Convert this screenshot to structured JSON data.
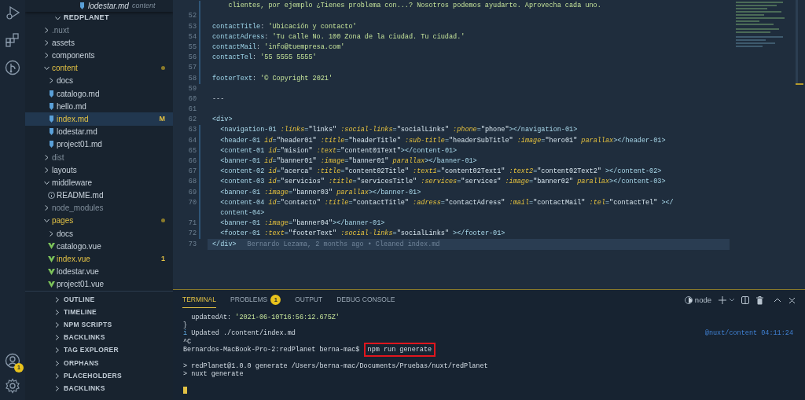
{
  "activity_bar": {
    "top": [
      {
        "kind": "run"
      },
      {
        "kind": "extensions"
      },
      {
        "kind": "git"
      }
    ],
    "bottom": [
      {
        "kind": "account",
        "badge": "1"
      },
      {
        "kind": "settings"
      }
    ]
  },
  "explorer": {
    "sticky": {
      "name": "lodestar.md",
      "detail": "content"
    },
    "root": "REDPLANET",
    "expanded": true,
    "items": [
      {
        "name": ".nuxt",
        "kind": "folder",
        "expanded": false,
        "ignored": true,
        "modified": false
      },
      {
        "name": "assets",
        "kind": "folder",
        "expanded": false,
        "ignored": false,
        "modified": false
      },
      {
        "name": "components",
        "kind": "folder",
        "expanded": false,
        "ignored": false,
        "modified": false
      },
      {
        "name": "content",
        "kind": "folder",
        "expanded": true,
        "ignored": false,
        "modified": true,
        "dot": true,
        "children": [
          {
            "name": "docs",
            "kind": "folder",
            "expanded": false,
            "ignored": false,
            "modified": false
          },
          {
            "name": "catalogo.md",
            "kind": "md",
            "ignored": false,
            "modified": false,
            "selected": false
          },
          {
            "name": "hello.md",
            "kind": "md",
            "ignored": false,
            "modified": false,
            "selected": false
          },
          {
            "name": "index.md",
            "kind": "md",
            "ignored": false,
            "modified": true,
            "badge": "M",
            "selected": true
          },
          {
            "name": "lodestar.md",
            "kind": "md",
            "ignored": false,
            "modified": false,
            "selected": false
          },
          {
            "name": "project01.md",
            "kind": "md",
            "ignored": false,
            "modified": false,
            "selected": false
          }
        ]
      },
      {
        "name": "dist",
        "kind": "folder",
        "expanded": false,
        "ignored": true,
        "modified": false
      },
      {
        "name": "layouts",
        "kind": "folder",
        "expanded": false,
        "ignored": false,
        "modified": false
      },
      {
        "name": "middleware",
        "kind": "folder",
        "expanded": true,
        "ignored": false,
        "modified": false,
        "children": [
          {
            "name": "README.md",
            "kind": "info",
            "ignored": false,
            "modified": false,
            "selected": false
          }
        ]
      },
      {
        "name": "node_modules",
        "kind": "folder",
        "expanded": false,
        "ignored": true,
        "modified": false
      },
      {
        "name": "pages",
        "kind": "folder",
        "expanded": true,
        "ignored": false,
        "modified": true,
        "dot": true,
        "children": [
          {
            "name": "docs",
            "kind": "folder",
            "expanded": false,
            "ignored": false,
            "modified": false
          },
          {
            "name": "catalogo.vue",
            "kind": "vue",
            "ignored": false,
            "modified": false,
            "selected": false
          },
          {
            "name": "index.vue",
            "kind": "vue",
            "ignored": false,
            "modified": true,
            "badge": "1",
            "selected": false
          },
          {
            "name": "lodestar.vue",
            "kind": "vue",
            "ignored": false,
            "modified": false,
            "selected": false
          },
          {
            "name": "project01.vue",
            "kind": "vue",
            "ignored": false,
            "modified": false,
            "selected": false
          }
        ]
      }
    ]
  },
  "sections": [
    {
      "label": "OUTLINE",
      "expanded": false
    },
    {
      "label": "TIMELINE",
      "expanded": false
    },
    {
      "label": "NPM SCRIPTS",
      "expanded": false
    },
    {
      "label": "BACKLINKS",
      "expanded": false
    },
    {
      "label": "TAG EXPLORER",
      "expanded": false
    },
    {
      "label": "ORPHANS",
      "expanded": false
    },
    {
      "label": "PLACEHOLDERS",
      "expanded": false
    },
    {
      "label": "BACKLINKS",
      "expanded": false
    }
  ],
  "editor": {
    "lines": [
      {
        "changed": true,
        "segments": [
          {
            "text": "    clientes, por ejemplo ¿Tienes problema con...? Nosotros podemos ayudarte. Aprovecha cada uno.",
            "kind": "str"
          }
        ]
      },
      {
        "number": "52",
        "changed": true
      },
      {
        "number": "53",
        "changed": true,
        "segments": [
          {
            "text": "contactTitle",
            "kind": "key"
          },
          {
            "text": ": ",
            "kind": "punct"
          },
          {
            "text": "'Ubicación y contacto'",
            "kind": "str"
          }
        ]
      },
      {
        "number": "54",
        "changed": true,
        "segments": [
          {
            "text": "contactAdress",
            "kind": "key"
          },
          {
            "text": ": ",
            "kind": "punct"
          },
          {
            "text": "'Tu calle No. 100 Zona de la ciudad. Tu ciudad.'",
            "kind": "str"
          }
        ]
      },
      {
        "number": "55",
        "changed": true,
        "segments": [
          {
            "text": "contactMail",
            "kind": "key"
          },
          {
            "text": ": ",
            "kind": "punct"
          },
          {
            "text": "'info@tuempresa.com'",
            "kind": "str"
          }
        ]
      },
      {
        "number": "56",
        "changed": true,
        "segments": [
          {
            "text": "contactTel",
            "kind": "key"
          },
          {
            "text": ": ",
            "kind": "punct"
          },
          {
            "text": "'55 5555 5555'",
            "kind": "str"
          }
        ]
      },
      {
        "number": "57",
        "changed": true
      },
      {
        "number": "58",
        "changed": true,
        "segments": [
          {
            "text": "footerText",
            "kind": "key"
          },
          {
            "text": ": ",
            "kind": "punct"
          },
          {
            "text": "'© Copyright 2021'",
            "kind": "str"
          }
        ]
      },
      {
        "number": "59",
        "changed": false
      },
      {
        "number": "60",
        "changed": false,
        "segments": [
          {
            "text": "---",
            "kind": "punct"
          }
        ]
      },
      {
        "number": "61",
        "changed": false
      },
      {
        "number": "62",
        "changed": false,
        "segments": [
          {
            "text": "<div>",
            "kind": "tag"
          }
        ]
      },
      {
        "number": "63",
        "changed": true,
        "segments": [
          {
            "text": "  <navigation-01 ",
            "kind": "tag"
          },
          {
            "text": ":links",
            "kind": "attr"
          },
          {
            "text": "=",
            "kind": "tag"
          },
          {
            "text": "\"links\" ",
            "kind": "val"
          },
          {
            "text": ":social-links",
            "kind": "attr"
          },
          {
            "text": "=",
            "kind": "tag"
          },
          {
            "text": "\"socialLinks\" ",
            "kind": "val"
          },
          {
            "text": ":phone",
            "kind": "attr"
          },
          {
            "text": "=",
            "kind": "tag"
          },
          {
            "text": "\"phone\"",
            "kind": "val"
          },
          {
            "text": "></navigation-01>",
            "kind": "tag"
          }
        ]
      },
      {
        "number": "64",
        "changed": true,
        "segments": [
          {
            "text": "  <header-01 ",
            "kind": "tag"
          },
          {
            "text": "id",
            "kind": "attr"
          },
          {
            "text": "=",
            "kind": "tag"
          },
          {
            "text": "\"header01\" ",
            "kind": "val"
          },
          {
            "text": ":title",
            "kind": "attr"
          },
          {
            "text": "=",
            "kind": "tag"
          },
          {
            "text": "\"headerTitle\" ",
            "kind": "val"
          },
          {
            "text": ":sub-title",
            "kind": "attr"
          },
          {
            "text": "=",
            "kind": "tag"
          },
          {
            "text": "\"headerSubTitle\" ",
            "kind": "val"
          },
          {
            "text": ":image",
            "kind": "attr"
          },
          {
            "text": "=",
            "kind": "tag"
          },
          {
            "text": "\"hero01\" ",
            "kind": "val"
          },
          {
            "text": "parallax",
            "kind": "attr"
          },
          {
            "text": "></header-01>",
            "kind": "tag"
          }
        ]
      },
      {
        "number": "65",
        "changed": true,
        "segments": [
          {
            "text": "  <content-01 ",
            "kind": "tag"
          },
          {
            "text": "id",
            "kind": "attr"
          },
          {
            "text": "=",
            "kind": "tag"
          },
          {
            "text": "\"mision\" ",
            "kind": "val"
          },
          {
            "text": ":text",
            "kind": "attr"
          },
          {
            "text": "=",
            "kind": "tag"
          },
          {
            "text": "\"content01Text\"",
            "kind": "val"
          },
          {
            "text": "></content-01>",
            "kind": "tag"
          }
        ]
      },
      {
        "number": "66",
        "changed": true,
        "segments": [
          {
            "text": "  <banner-01 ",
            "kind": "tag"
          },
          {
            "text": "id",
            "kind": "attr"
          },
          {
            "text": "=",
            "kind": "tag"
          },
          {
            "text": "\"banner01\" ",
            "kind": "val"
          },
          {
            "text": ":image",
            "kind": "attr"
          },
          {
            "text": "=",
            "kind": "tag"
          },
          {
            "text": "\"banner01\" ",
            "kind": "val"
          },
          {
            "text": "parallax",
            "kind": "attr"
          },
          {
            "text": "></banner-01>",
            "kind": "tag"
          }
        ]
      },
      {
        "number": "67",
        "changed": true,
        "segments": [
          {
            "text": "  <content-02 ",
            "kind": "tag"
          },
          {
            "text": "id",
            "kind": "attr"
          },
          {
            "text": "=",
            "kind": "tag"
          },
          {
            "text": "\"acerca\" ",
            "kind": "val"
          },
          {
            "text": ":title",
            "kind": "attr"
          },
          {
            "text": "=",
            "kind": "tag"
          },
          {
            "text": "\"content02Title\" ",
            "kind": "val"
          },
          {
            "text": ":text1",
            "kind": "attr"
          },
          {
            "text": "=",
            "kind": "tag"
          },
          {
            "text": "\"content02Text1\" ",
            "kind": "val"
          },
          {
            "text": ":text2",
            "kind": "attr"
          },
          {
            "text": "=",
            "kind": "tag"
          },
          {
            "text": "\"content02Text2\"",
            "kind": "val"
          },
          {
            "text": " ></content-02>",
            "kind": "tag"
          }
        ]
      },
      {
        "number": "68",
        "changed": true,
        "segments": [
          {
            "text": "  <content-03 ",
            "kind": "tag"
          },
          {
            "text": "id",
            "kind": "attr"
          },
          {
            "text": "=",
            "kind": "tag"
          },
          {
            "text": "\"servicios\" ",
            "kind": "val"
          },
          {
            "text": ":title",
            "kind": "attr"
          },
          {
            "text": "=",
            "kind": "tag"
          },
          {
            "text": "\"servicesTitle\" ",
            "kind": "val"
          },
          {
            "text": ":services",
            "kind": "attr"
          },
          {
            "text": "=",
            "kind": "tag"
          },
          {
            "text": "\"services\" ",
            "kind": "val"
          },
          {
            "text": ":image",
            "kind": "attr"
          },
          {
            "text": "=",
            "kind": "tag"
          },
          {
            "text": "\"banner02\" ",
            "kind": "val"
          },
          {
            "text": "parallax",
            "kind": "attr"
          },
          {
            "text": "></content-03>",
            "kind": "tag"
          }
        ]
      },
      {
        "number": "69",
        "changed": true,
        "segments": [
          {
            "text": "  <banner-01 ",
            "kind": "tag"
          },
          {
            "text": ":image",
            "kind": "attr"
          },
          {
            "text": "=",
            "kind": "tag"
          },
          {
            "text": "\"banner03\" ",
            "kind": "val"
          },
          {
            "text": "parallax",
            "kind": "attr"
          },
          {
            "text": "></banner-01>",
            "kind": "tag"
          }
        ]
      },
      {
        "number": "70",
        "changed": true,
        "segments": [
          {
            "text": "  <content-04 ",
            "kind": "tag"
          },
          {
            "text": "id",
            "kind": "attr"
          },
          {
            "text": "=",
            "kind": "tag"
          },
          {
            "text": "\"contacto\" ",
            "kind": "val"
          },
          {
            "text": ":title",
            "kind": "attr"
          },
          {
            "text": "=",
            "kind": "tag"
          },
          {
            "text": "\"contactTitle\" ",
            "kind": "val"
          },
          {
            "text": ":adress",
            "kind": "attr"
          },
          {
            "text": "=",
            "kind": "tag"
          },
          {
            "text": "\"contactAdress\" ",
            "kind": "val"
          },
          {
            "text": ":mail",
            "kind": "attr"
          },
          {
            "text": "=",
            "kind": "tag"
          },
          {
            "text": "\"contactMail\" ",
            "kind": "val"
          },
          {
            "text": ":tel",
            "kind": "attr"
          },
          {
            "text": "=",
            "kind": "tag"
          },
          {
            "text": "\"contactTel\"",
            "kind": "val"
          },
          {
            "text": " ></",
            "kind": "tag"
          }
        ]
      },
      {
        "changed": true,
        "segments": [
          {
            "text": "  content-04>",
            "kind": "tag"
          }
        ]
      },
      {
        "number": "71",
        "changed": true,
        "segments": [
          {
            "text": "  <banner-01 ",
            "kind": "tag"
          },
          {
            "text": ":image",
            "kind": "attr"
          },
          {
            "text": "=",
            "kind": "tag"
          },
          {
            "text": "\"banner04\"",
            "kind": "val"
          },
          {
            "text": "></banner-01>",
            "kind": "tag"
          }
        ]
      },
      {
        "number": "72",
        "changed": true,
        "segments": [
          {
            "text": "  <footer-01 ",
            "kind": "tag"
          },
          {
            "text": ":text",
            "kind": "attr"
          },
          {
            "text": "=",
            "kind": "tag"
          },
          {
            "text": "\"footerText\" ",
            "kind": "val"
          },
          {
            "text": ":social-links",
            "kind": "attr"
          },
          {
            "text": "=",
            "kind": "tag"
          },
          {
            "text": "\"socialLinks\"",
            "kind": "val"
          },
          {
            "text": " ></footer-01>",
            "kind": "tag"
          }
        ]
      },
      {
        "number": "73",
        "changed": false,
        "current": true,
        "blame": "Bernardo Lezama, 2 months ago • Cleaned index.md",
        "segments": [
          {
            "text": "</div>",
            "kind": "tag"
          }
        ]
      }
    ]
  },
  "panel": {
    "tabs": [
      {
        "label": "TERMINAL",
        "selected": true
      },
      {
        "label": "PROBLEMS",
        "badge": "1",
        "selected": false
      },
      {
        "label": "OUTPUT",
        "selected": false
      },
      {
        "label": "DEBUG CONSOLE",
        "selected": false
      }
    ],
    "shell": "node",
    "terminal": [
      {
        "spaced": false,
        "segments": [
          {
            "text": "  updatedAt: ",
            "kind": "plain"
          },
          {
            "text": "'2021-06-10T16:56:12.675Z'",
            "kind": "str"
          }
        ]
      },
      {
        "spaced": false,
        "segments": [
          {
            "text": "}",
            "kind": "plain"
          }
        ]
      },
      {
        "spaced": false,
        "segments": [
          {
            "text": "i",
            "kind": "info"
          },
          {
            "text": " Updated ./content/index.md",
            "kind": "plain"
          }
        ],
        "aside": "@nuxt/content 04:11:24"
      },
      {
        "spaced": false,
        "segments": [
          {
            "text": "^C",
            "kind": "plain"
          }
        ]
      },
      {
        "spaced": false,
        "segments": [
          {
            "text": "Bernardos-MacBook-Pro-2:redPlanet berna-mac$ ",
            "kind": "plain"
          },
          {
            "text": "npm run generate",
            "kind": "boxed"
          }
        ]
      },
      {
        "spaced": true,
        "segments": [
          {
            "text": "> redPlanet@1.0.0 generate /Users/berna-mac/Documents/Pruebas/nuxt/redPlanet",
            "kind": "plain"
          }
        ]
      },
      {
        "spaced": false,
        "segments": [
          {
            "text": "> nuxt generate",
            "kind": "plain"
          }
        ]
      },
      {
        "spaced": true,
        "cursor": true
      }
    ]
  }
}
